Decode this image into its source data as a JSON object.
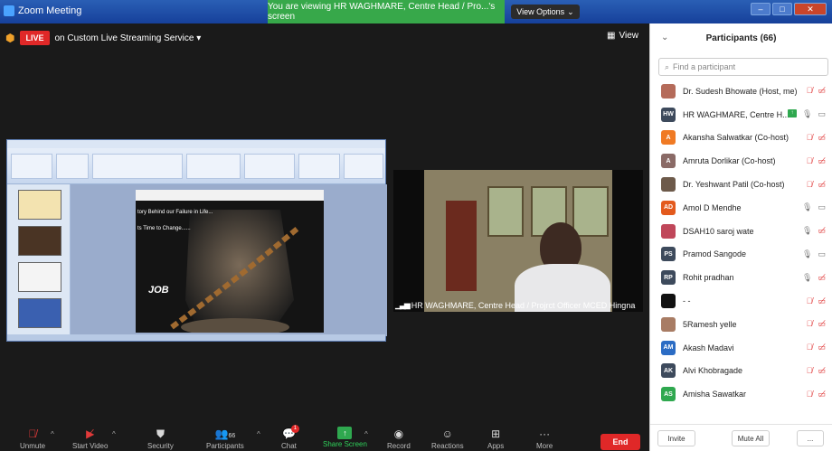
{
  "titlebar": {
    "app_title": "Zoom Meeting",
    "viewing_text": "You are viewing HR WAGHMARE, Centre Head / Pro...'s screen",
    "view_options_label": "View Options"
  },
  "meeting": {
    "live_label": "LIVE",
    "live_service": "on Custom Live Streaming Service",
    "view_label": "View",
    "slide_line1": "tory Behind our Failure in Life...",
    "slide_line2": "ts Time to Change......",
    "slide_word": "JOB",
    "video_name": "HR WAGHMARE, Centre Head / Projrct Officer MCED Hingna"
  },
  "toolbar": {
    "unmute": "Unmute",
    "start_video": "Start Video",
    "security": "Security",
    "participants": "Participants",
    "participants_count": "66",
    "chat": "Chat",
    "chat_badge": "1",
    "share_screen": "Share Screen",
    "record": "Record",
    "reactions": "Reactions",
    "apps": "Apps",
    "more": "More",
    "end": "End"
  },
  "panel": {
    "title": "Participants (66)",
    "search_placeholder": "Find a participant",
    "invite": "Invite",
    "mute_all": "Mute All",
    "more": "...",
    "participants": [
      {
        "name": "Dr. Sudesh Bhowate (Host, me)",
        "initials": "",
        "avatar_color": "#b56b5a",
        "mic": "muted",
        "cam": "off"
      },
      {
        "name": "HR WAGHMARE, Centre H...",
        "initials": "HW",
        "avatar_color": "#3d4a5c",
        "mic": "on",
        "cam": "on",
        "sharing": true
      },
      {
        "name": "Akansha Salwatkar (Co-host)",
        "initials": "A",
        "avatar_color": "#f07a24",
        "mic": "muted",
        "cam": "off"
      },
      {
        "name": "Amruta Dorlikar (Co-host)",
        "initials": "A",
        "avatar_color": "#8a6a66",
        "mic": "muted",
        "cam": "off"
      },
      {
        "name": "Dr. Yeshwant Patil (Co-host)",
        "initials": "",
        "avatar_color": "#6d5a4a",
        "mic": "muted",
        "cam": "off"
      },
      {
        "name": "Amol  D Mendhe",
        "initials": "AD",
        "avatar_color": "#e35a1d",
        "mic": "on",
        "cam": "on"
      },
      {
        "name": "DSAH10 saroj wate",
        "initials": "",
        "avatar_color": "#c0475a",
        "mic": "on",
        "cam": "off"
      },
      {
        "name": "Pramod Sangode",
        "initials": "PS",
        "avatar_color": "#3d4a5c",
        "mic": "on",
        "cam": "on"
      },
      {
        "name": "Rohit  pradhan",
        "initials": "RP",
        "avatar_color": "#3d4a5c",
        "mic": "on",
        "cam": "off"
      },
      {
        "name": "- -",
        "initials": "",
        "avatar_color": "#111111",
        "mic": "muted",
        "cam": "off"
      },
      {
        "name": "5Ramesh yelle",
        "initials": "",
        "avatar_color": "#a87c64",
        "mic": "muted",
        "cam": "off"
      },
      {
        "name": "Akash Madavi",
        "initials": "AM",
        "avatar_color": "#2b6cc4",
        "mic": "muted",
        "cam": "off"
      },
      {
        "name": "Alvi Khobragade",
        "initials": "AK",
        "avatar_color": "#3d4a5c",
        "mic": "muted",
        "cam": "off"
      },
      {
        "name": "Amisha Sawatkar",
        "initials": "AS",
        "avatar_color": "#2fa84f",
        "mic": "muted",
        "cam": "off"
      }
    ]
  }
}
